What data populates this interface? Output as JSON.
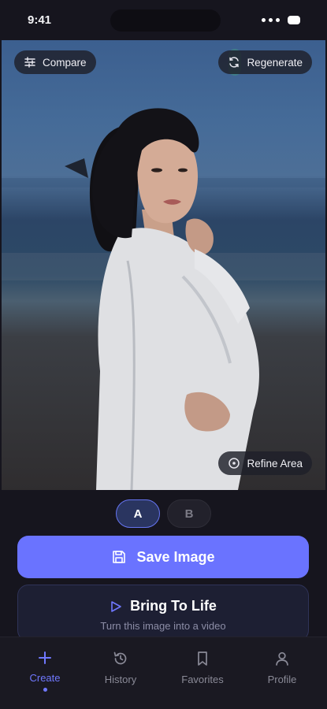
{
  "status_bar": {
    "time": "9:41"
  },
  "photo": {
    "compare_label": "Compare",
    "regenerate_label": "Regenerate",
    "refine_label": "Refine Area"
  },
  "variant_toggle": {
    "a_label": "A",
    "b_label": "B",
    "selected": "A"
  },
  "actions": {
    "save_label": "Save Image",
    "life_title": "Bring To Life",
    "life_subtitle": "Turn this image into a video"
  },
  "nav": {
    "items": [
      {
        "label": "Create",
        "icon": "plus-icon",
        "active": true
      },
      {
        "label": "History",
        "icon": "history-icon",
        "active": false
      },
      {
        "label": "Favorites",
        "icon": "bookmark-icon",
        "active": false
      },
      {
        "label": "Profile",
        "icon": "person-icon",
        "active": false
      }
    ]
  },
  "colors": {
    "accent": "#6a73ff",
    "background": "#16151e"
  }
}
